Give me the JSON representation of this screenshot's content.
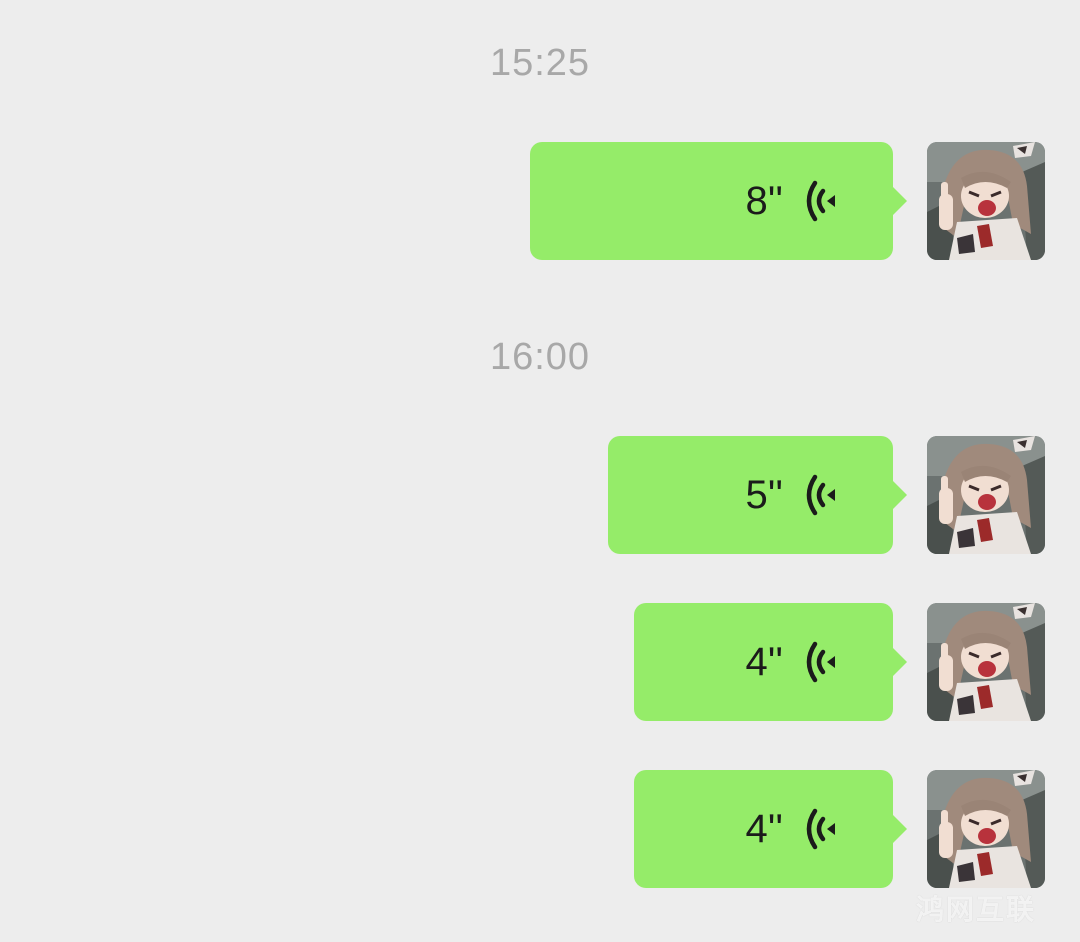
{
  "chat": {
    "timestamps": [
      "15:25",
      "16:00"
    ],
    "messages": [
      {
        "duration": "8''",
        "icon": "voice-wave-icon",
        "sender": "self"
      },
      {
        "duration": "5''",
        "icon": "voice-wave-icon",
        "sender": "self"
      },
      {
        "duration": "4''",
        "icon": "voice-wave-icon",
        "sender": "self"
      },
      {
        "duration": "4''",
        "icon": "voice-wave-icon",
        "sender": "self"
      }
    ]
  },
  "watermark": "鸿网互联",
  "colors": {
    "background": "#ededed",
    "bubble": "#95ec69",
    "timestamp_text": "#a8a8a8",
    "message_text": "#1b1b1b"
  }
}
